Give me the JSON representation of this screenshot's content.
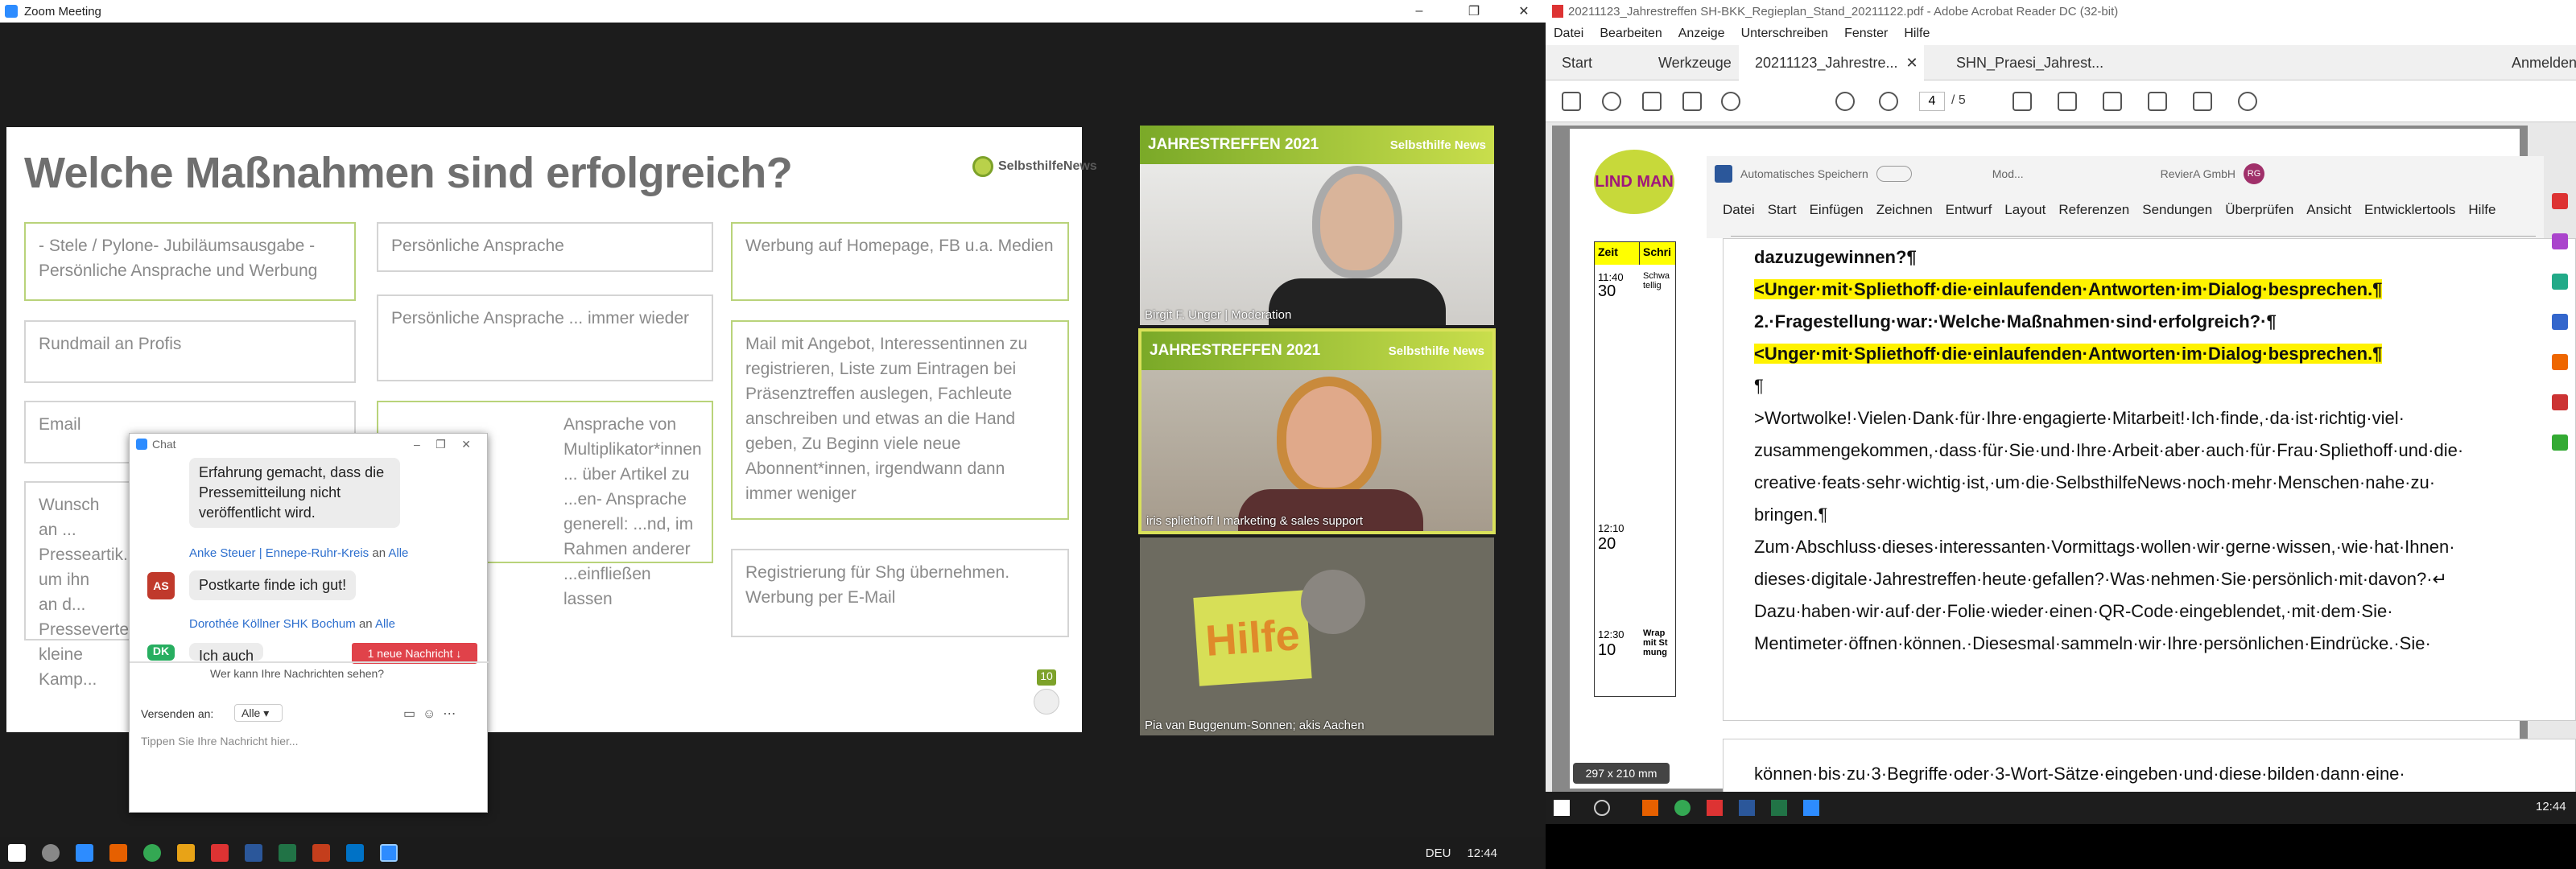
{
  "zoom": {
    "window_title": "Zoom Meeting",
    "slide": {
      "title": "Welche Maßnahmen sind erfolgreich?",
      "logo": "SelbsthilfeNews",
      "cards": [
        "- Stele / Pylone- Jubiläumsausgabe - Persönliche Ansprache und Werbung",
        "Persönliche Ansprache",
        "Werbung auf Homepage, FB u.a. Medien",
        "Rundmail an Profis",
        "Persönliche Ansprache ... immer wieder",
        "Mail mit Angebot, Interessentinnen zu registrieren, Liste zum Eintragen bei Präsenztreffen auslegen, Fachleute anschreiben und etwas an die Hand geben, Zu Beginn viele neue Abonnent*innen, irgendwann dann immer weniger",
        "Email",
        "Ansprache von Multiplikator*innen ... über Artikel zu ...en- Ansprache generell: ...nd, im Rahmen anderer ...einfließen lassen",
        "Wunsch an ... Presseartik... um ihn an d... Presseverte... kleine Kamp...",
        "Registrierung für Shg übernehmen. Werbung per E-Mail"
      ],
      "page_badge": "10"
    },
    "videos": [
      {
        "label": "Birgit F. Unger | Moderation",
        "banner": "JAHRESTREFFEN 2021",
        "logo": "Selbsthilfe News"
      },
      {
        "label": "iris spliethoff I marketing & sales support",
        "banner": "JAHRESTREFFEN 2021",
        "logo": "Selbsthilfe News"
      },
      {
        "label": "Pia van Buggenum-Sonnen; akis Aachen",
        "sign": "Hilfe"
      }
    ],
    "chat": {
      "title": "Chat",
      "msg1": "Erfahrung gemacht, dass die Pressemitteilung nicht veröffentlicht wird.",
      "sender2": "Anke Steuer | Ennepe-Ruhr-Kreis",
      "to": "an",
      "to_all": "Alle",
      "initials2": "AS",
      "msg2": "Postkarte finde ich gut!",
      "sender3": "Dorothée Köllner SHK Bochum",
      "initials3": "DK",
      "msg3": "Ich auch",
      "new_msg": "1 neue Nachricht ↓",
      "who_sees": "Wer kann Ihre Nachrichten sehen?",
      "send_to": "Versenden an:",
      "send_to_value": "Alle",
      "placeholder": "Tippen Sie Ihre Nachricht hier..."
    },
    "taskbar": {
      "lang": "DEU",
      "time": "12:44"
    }
  },
  "acrobat": {
    "window_title": "20211123_Jahrestreffen SH-BKK_Regieplan_Stand_20211122.pdf - Adobe Acrobat Reader DC (32-bit)",
    "menu": [
      "Datei",
      "Bearbeiten",
      "Anzeige",
      "Unterschreiben",
      "Fenster",
      "Hilfe"
    ],
    "tabs": [
      "Start",
      "Werkzeuge",
      "20211123_Jahrestre...",
      "SHN_Praesi_Jahrest..."
    ],
    "login": "Anmelden",
    "page_current": "4",
    "page_total": "/ 5",
    "page_size": "297 x 210 mm",
    "table": {
      "header1": "Zeit",
      "header2": "Schri",
      "rows": [
        [
          "11:40",
          "30",
          "Schwa tellig"
        ],
        [
          "12:10",
          "20",
          ""
        ],
        [
          "12:30",
          "10",
          "Wrap mit St mung"
        ]
      ]
    },
    "logo": "LIND MAN"
  },
  "word": {
    "autosave": "Automatisches Speichern",
    "mode": "Mod...",
    "user": "RevierA GmbH",
    "initials": "RG",
    "ribbon": [
      "Datei",
      "Start",
      "Einfügen",
      "Zeichnen",
      "Entwurf",
      "Layout",
      "Referenzen",
      "Sendungen",
      "Überprüfen",
      "Ansicht",
      "Entwicklertools",
      "Hilfe"
    ],
    "lines": [
      "dazuzugewinnen?¶",
      "<Unger·mit·Spliethoff·die·einlaufenden·Antworten·im·Dialog·besprechen.¶",
      "2.·Fragestellung·war:·Welche·Maßnahmen·sind·erfolgreich?·¶",
      "<Unger·mit·Spliethoff·die·einlaufenden·Antworten·im·Dialog·besprechen.¶",
      "¶",
      ">Wortwolke!·Vielen·Dank·für·Ihre·engagierte·Mitarbeit!·Ich·finde,·da·ist·richtig·viel·",
      "zusammengekommen,·dass·für·Sie·und·Ihre·Arbeit·aber·auch·für·Frau·Spliethoff·und·die·",
      "creative·feats·sehr·wichtig·ist,·um·die·SelbsthilfeNews·noch·mehr·Menschen·nahe·zu·",
      "bringen.¶",
      "Zum·Abschluss·dieses·interessanten·Vormittags·wollen·wir·gerne·wissen,·wie·hat·Ihnen·",
      "dieses·digitale·Jahrestreffen·heute·gefallen?·Was·nehmen·Sie·persönlich·mit·davon?·↵",
      "Dazu·haben·wir·auf·der·Folie·wieder·einen·QR-Code·eingeblendet,·mit·dem·Sie·",
      "Mentimeter·öffnen·können.·Diesesmal·sammeln·wir·Ihre·persönlichen·Eindrücke.·Sie·"
    ],
    "line_next": "können·bis·zu·3·Begriffe·oder·3-Wort-Sätze·eingeben·und·diese·bilden·dann·eine·"
  },
  "taskbar_right": {
    "time": "12:44"
  }
}
